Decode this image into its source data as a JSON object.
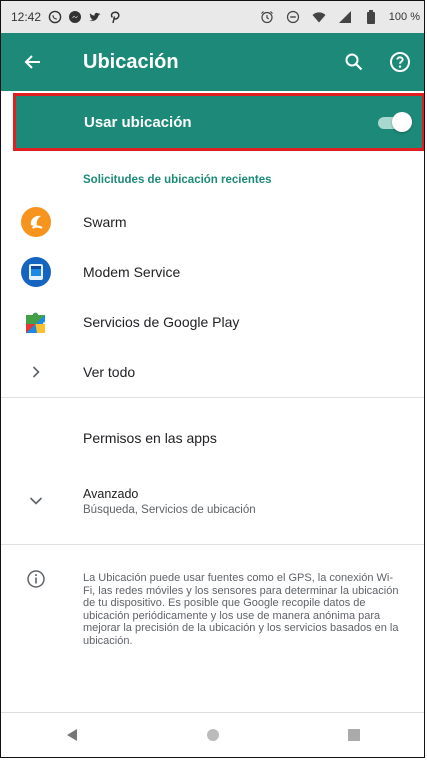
{
  "status_bar": {
    "time": "12:42",
    "battery_text": "100 %"
  },
  "app_bar": {
    "title": "Ubicación",
    "back_icon": "arrow-back-icon",
    "actions": [
      {
        "icon": "search-icon"
      },
      {
        "icon": "help-icon"
      }
    ]
  },
  "master_switch": {
    "label": "Usar ubicación",
    "enabled": true
  },
  "recent_requests": {
    "header": "Solicitudes de ubicación recientes",
    "items": [
      {
        "label": "Swarm",
        "icon": "swarm-app-icon"
      },
      {
        "label": "Modem Service",
        "icon": "modem-service-app-icon"
      },
      {
        "label": "Servicios de Google Play",
        "icon": "google-play-services-app-icon"
      }
    ],
    "see_all": "Ver todo"
  },
  "app_permissions": {
    "label": "Permisos en las apps"
  },
  "advanced": {
    "title": "Avanzado",
    "summary": "Búsqueda, Servicios de ubicación"
  },
  "info": {
    "text": "La Ubicación puede usar fuentes como el GPS, la conexión Wi-Fi, las redes móviles y los sensores para determinar la ubicación de tu dispositivo. Es posible que Google recopile datos de ubicación periódicamente y los use de manera anónima para mejorar la precisión de la ubicación y los servicios basados en la ubicación."
  },
  "colors": {
    "accent": "#1d8a79",
    "highlight_border": "#e02020"
  }
}
